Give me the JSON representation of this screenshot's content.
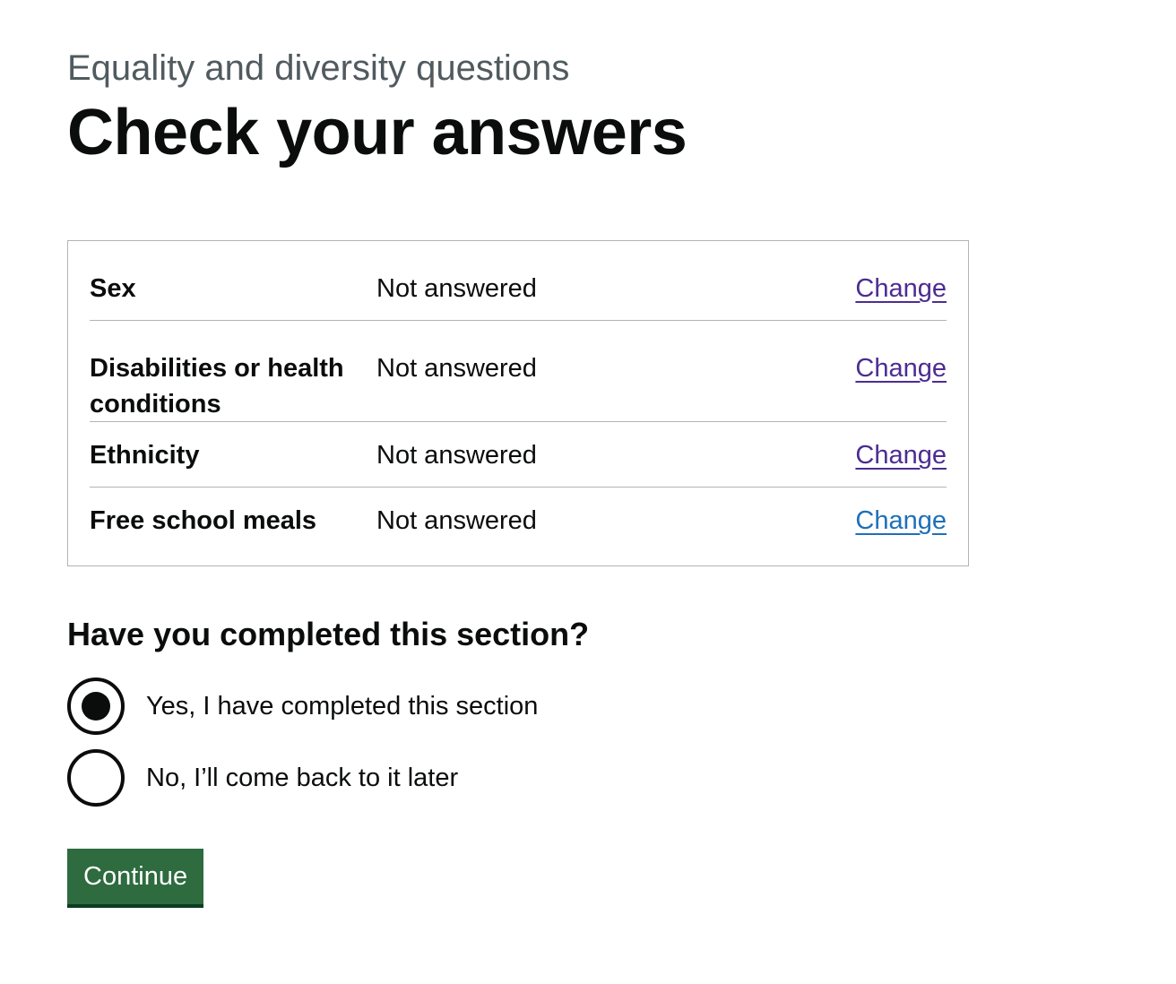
{
  "header": {
    "caption": "Equality and diversity questions",
    "title": "Check your answers"
  },
  "summary": {
    "rows": [
      {
        "key": "Sex",
        "value": "Not answered",
        "action": "Change",
        "visited": true
      },
      {
        "key": "Disabilities or health conditions",
        "value": "Not answered",
        "action": "Change",
        "visited": true
      },
      {
        "key": "Ethnicity",
        "value": "Not answered",
        "action": "Change",
        "visited": true
      },
      {
        "key": "Free school meals",
        "value": "Not answered",
        "action": "Change",
        "visited": false
      }
    ]
  },
  "completion": {
    "question": "Have you completed this section?",
    "options": [
      {
        "label": "Yes, I have completed this section",
        "selected": true
      },
      {
        "label": "No, I’ll come back to it later",
        "selected": false
      }
    ]
  },
  "actions": {
    "continue_label": "Continue"
  },
  "colors": {
    "link_visited": "#4c2c92",
    "link": "#1d70b8",
    "button": "#2e6b3f",
    "text": "#0b0c0c",
    "secondary_text": "#505a5f",
    "border": "#b1b4b6"
  }
}
